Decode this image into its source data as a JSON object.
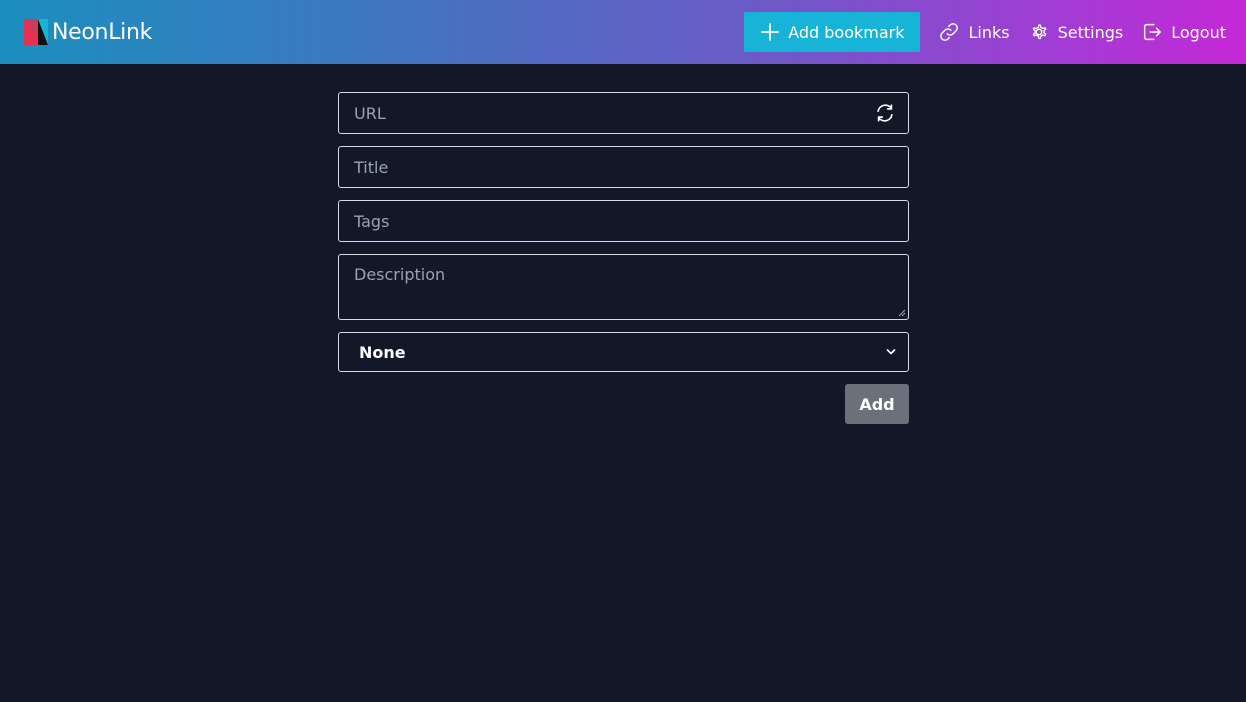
{
  "brand": {
    "name": "NeonLink",
    "logo_icon": "neonlink-logo-icon"
  },
  "nav": {
    "add_bookmark_label": "Add bookmark",
    "links_label": "Links",
    "settings_label": "Settings",
    "logout_label": "Logout",
    "icons": [
      "plus-icon",
      "link-icon",
      "gear-icon",
      "logout-icon"
    ]
  },
  "form": {
    "url": {
      "placeholder": "URL",
      "value": ""
    },
    "title": {
      "placeholder": "Title",
      "value": ""
    },
    "tags": {
      "placeholder": "Tags",
      "value": ""
    },
    "description": {
      "placeholder": "Description",
      "value": ""
    },
    "category_select": {
      "selected": "None"
    },
    "submit_label": "Add"
  },
  "colors": {
    "background": "#121827",
    "accent": "#18b4d8",
    "gradient_start": "#1b8fbd",
    "gradient_end": "#c528d6",
    "submit_button": "#6b717b"
  }
}
